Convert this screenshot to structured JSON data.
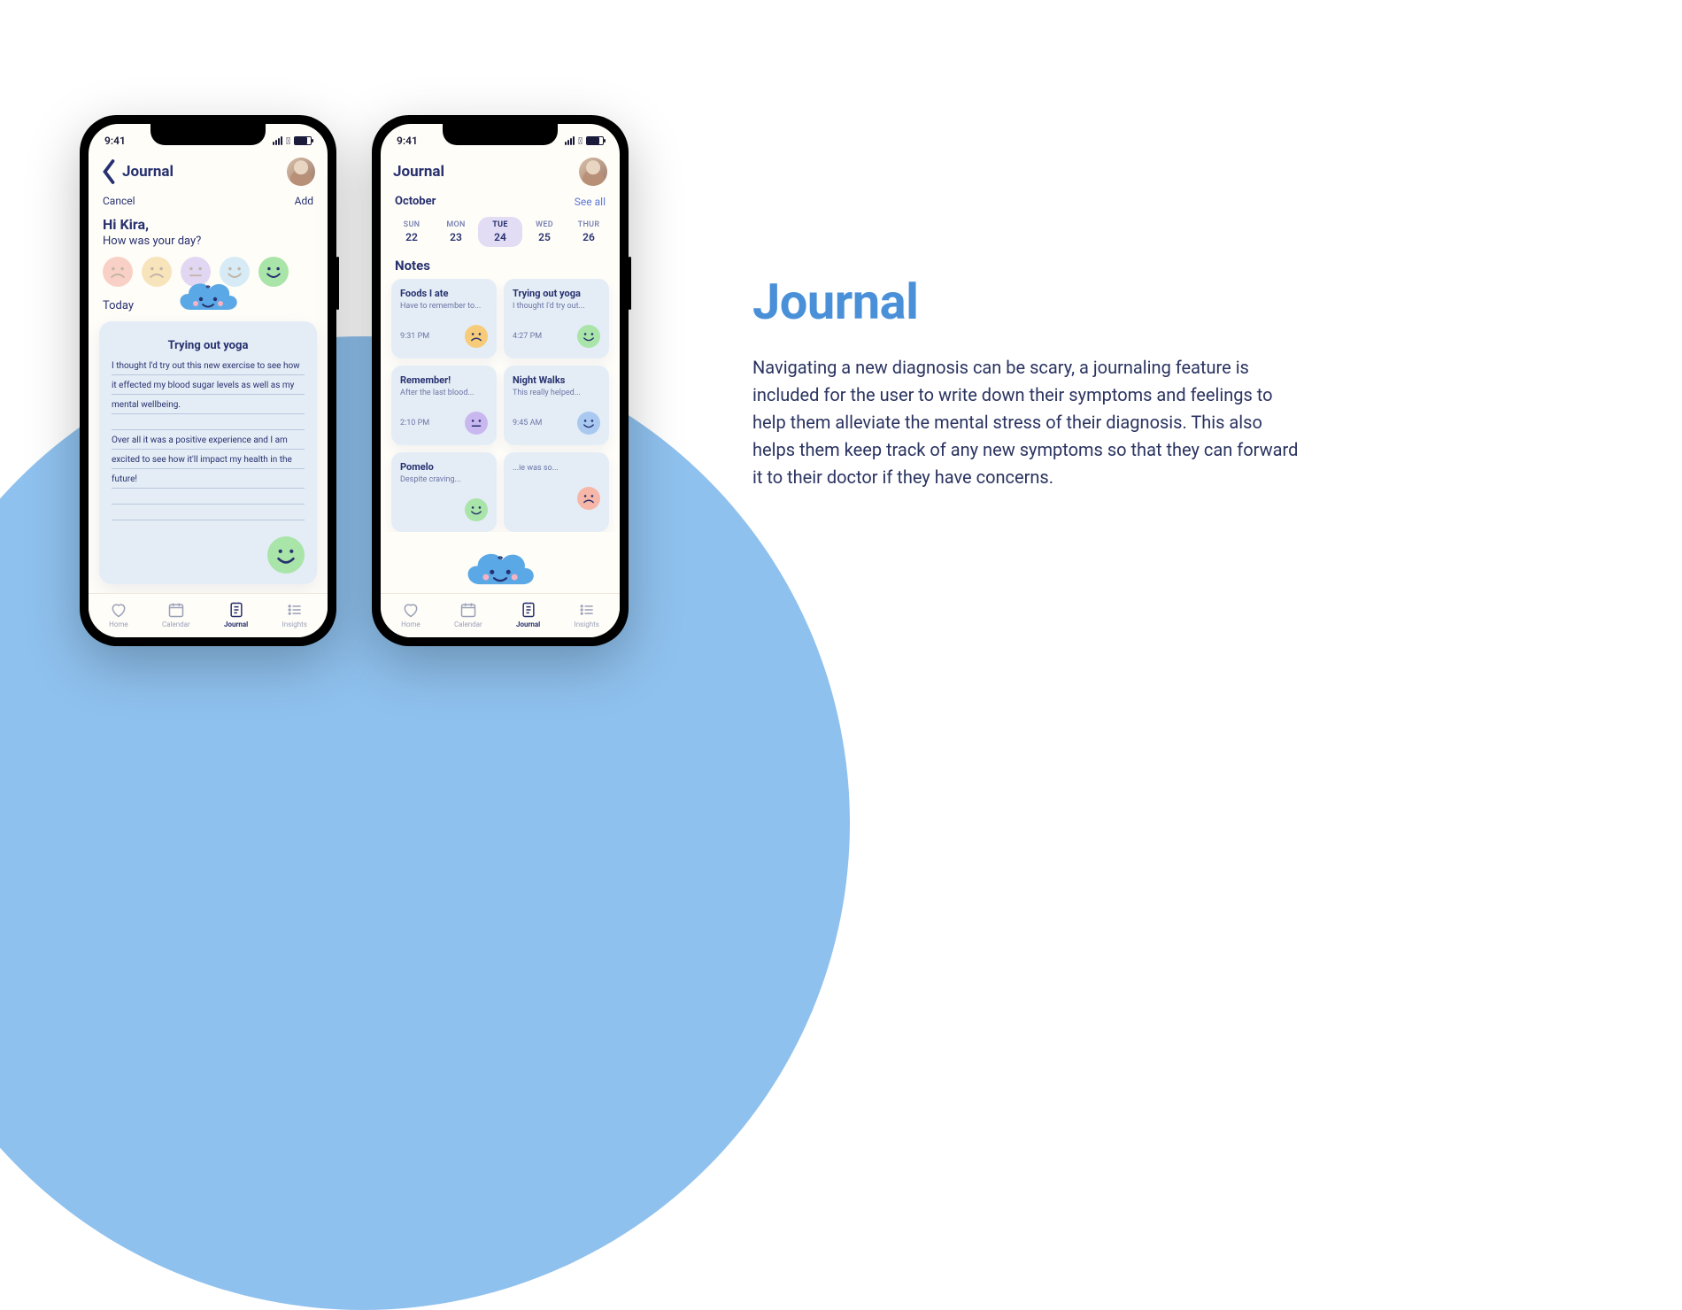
{
  "status_time": "9:41",
  "screen1": {
    "title": "Journal",
    "cancel": "Cancel",
    "add": "Add",
    "greeting_name": "Hi Kira,",
    "greeting_q": "How was your day?",
    "today_label": "Today",
    "entry": {
      "title": "Trying out yoga",
      "p1": "I thought I'd try out this new exercise to see how",
      "p2": "it effected my blood sugar levels as well as my",
      "p3": "mental wellbeing.",
      "p4": "Over all it was a positive experience and I am",
      "p5": "excited to see how it'll impact my health in the",
      "p6": "future!"
    }
  },
  "screen2": {
    "title": "Journal",
    "month": "October",
    "see_all": "See all",
    "days": [
      {
        "dow": "SUN",
        "num": "22"
      },
      {
        "dow": "MON",
        "num": "23"
      },
      {
        "dow": "TUE",
        "num": "24",
        "selected": true
      },
      {
        "dow": "WED",
        "num": "25"
      },
      {
        "dow": "THUR",
        "num": "26"
      }
    ],
    "notes_title": "Notes",
    "notes": [
      {
        "title": "Foods I ate",
        "excerpt": "Have to remember to...",
        "time": "9:31 PM",
        "mood": "#f6cc7a",
        "face": "sad"
      },
      {
        "title": "Trying out yoga",
        "excerpt": "I thought I'd try out...",
        "time": "4:27 PM",
        "mood": "#a9e4a9",
        "face": "happy"
      },
      {
        "title": "Remember!",
        "excerpt": "After the last blood...",
        "time": "2:10 PM",
        "mood": "#c9b8ef",
        "face": "neutral"
      },
      {
        "title": "Night Walks",
        "excerpt": "This really helped...",
        "time": "9:45 AM",
        "mood": "#a9c9f0",
        "face": "happy"
      },
      {
        "title": "Pomelo",
        "excerpt": "Despite craving...",
        "time": "",
        "mood": "#a9e4a9",
        "face": "happy"
      },
      {
        "title": "",
        "excerpt": "...ie was so...",
        "time": "",
        "mood": "#f6b7a9",
        "face": "sad"
      }
    ]
  },
  "nav": {
    "home": "Home",
    "calendar": "Calendar",
    "journal": "Journal",
    "insights": "Insights"
  },
  "copy": {
    "heading": "Journal",
    "body": "Navigating a new diagnosis can be scary, a journaling feature is included for the user to write down their symptoms and feelings to help them alleviate the mental stress of their diagnosis. This also helps them keep track of any new symptoms so that they can forward it to their doctor if they have concerns."
  },
  "moods": [
    {
      "bg": "#f8c9bd",
      "face": "sad"
    },
    {
      "bg": "#f7e0b1",
      "face": "sad"
    },
    {
      "bg": "#dcd1f2",
      "face": "neutral"
    },
    {
      "bg": "#cfe8f5",
      "face": "happy"
    },
    {
      "bg": "#a9e4a9",
      "face": "happy",
      "selected": true
    }
  ]
}
